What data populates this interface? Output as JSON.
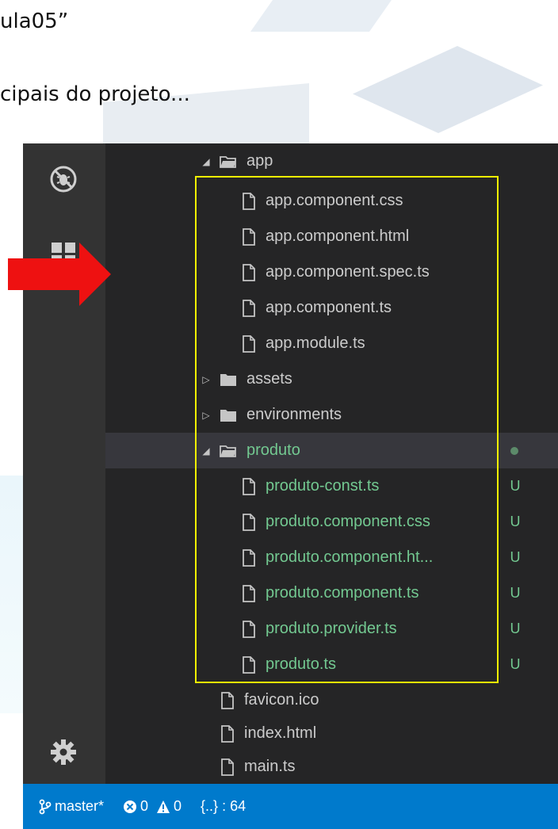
{
  "slide": {
    "line1": "ula05”",
    "line2": "cipais do projeto..."
  },
  "colors": {
    "accent_status": "#007acc",
    "git_untracked": "#73c991",
    "highlight_box": "#f0f000",
    "arrow": "#ee1111"
  },
  "activity_bar": {
    "icons": [
      "debug-icon",
      "extensions-icon",
      "settings-gear-icon"
    ]
  },
  "tree": {
    "app_folder": "app",
    "app_files": [
      "app.component.css",
      "app.component.html",
      "app.component.spec.ts",
      "app.component.ts",
      "app.module.ts"
    ],
    "assets_folder": "assets",
    "environments_folder": "environments",
    "produto_folder": "produto",
    "produto_files": [
      {
        "name": "produto-const.ts",
        "status": "U"
      },
      {
        "name": "produto.component.css",
        "status": "U"
      },
      {
        "name": "produto.component.ht...",
        "status": "U"
      },
      {
        "name": "produto.component.ts",
        "status": "U"
      },
      {
        "name": "produto.provider.ts",
        "status": "U"
      },
      {
        "name": "produto.ts",
        "status": "U"
      }
    ],
    "root_files": [
      "favicon.ico",
      "index.html",
      "main.ts"
    ]
  },
  "status_bar": {
    "branch": "master*",
    "errors": "0",
    "warnings": "0",
    "braces": "{..} : 64"
  }
}
